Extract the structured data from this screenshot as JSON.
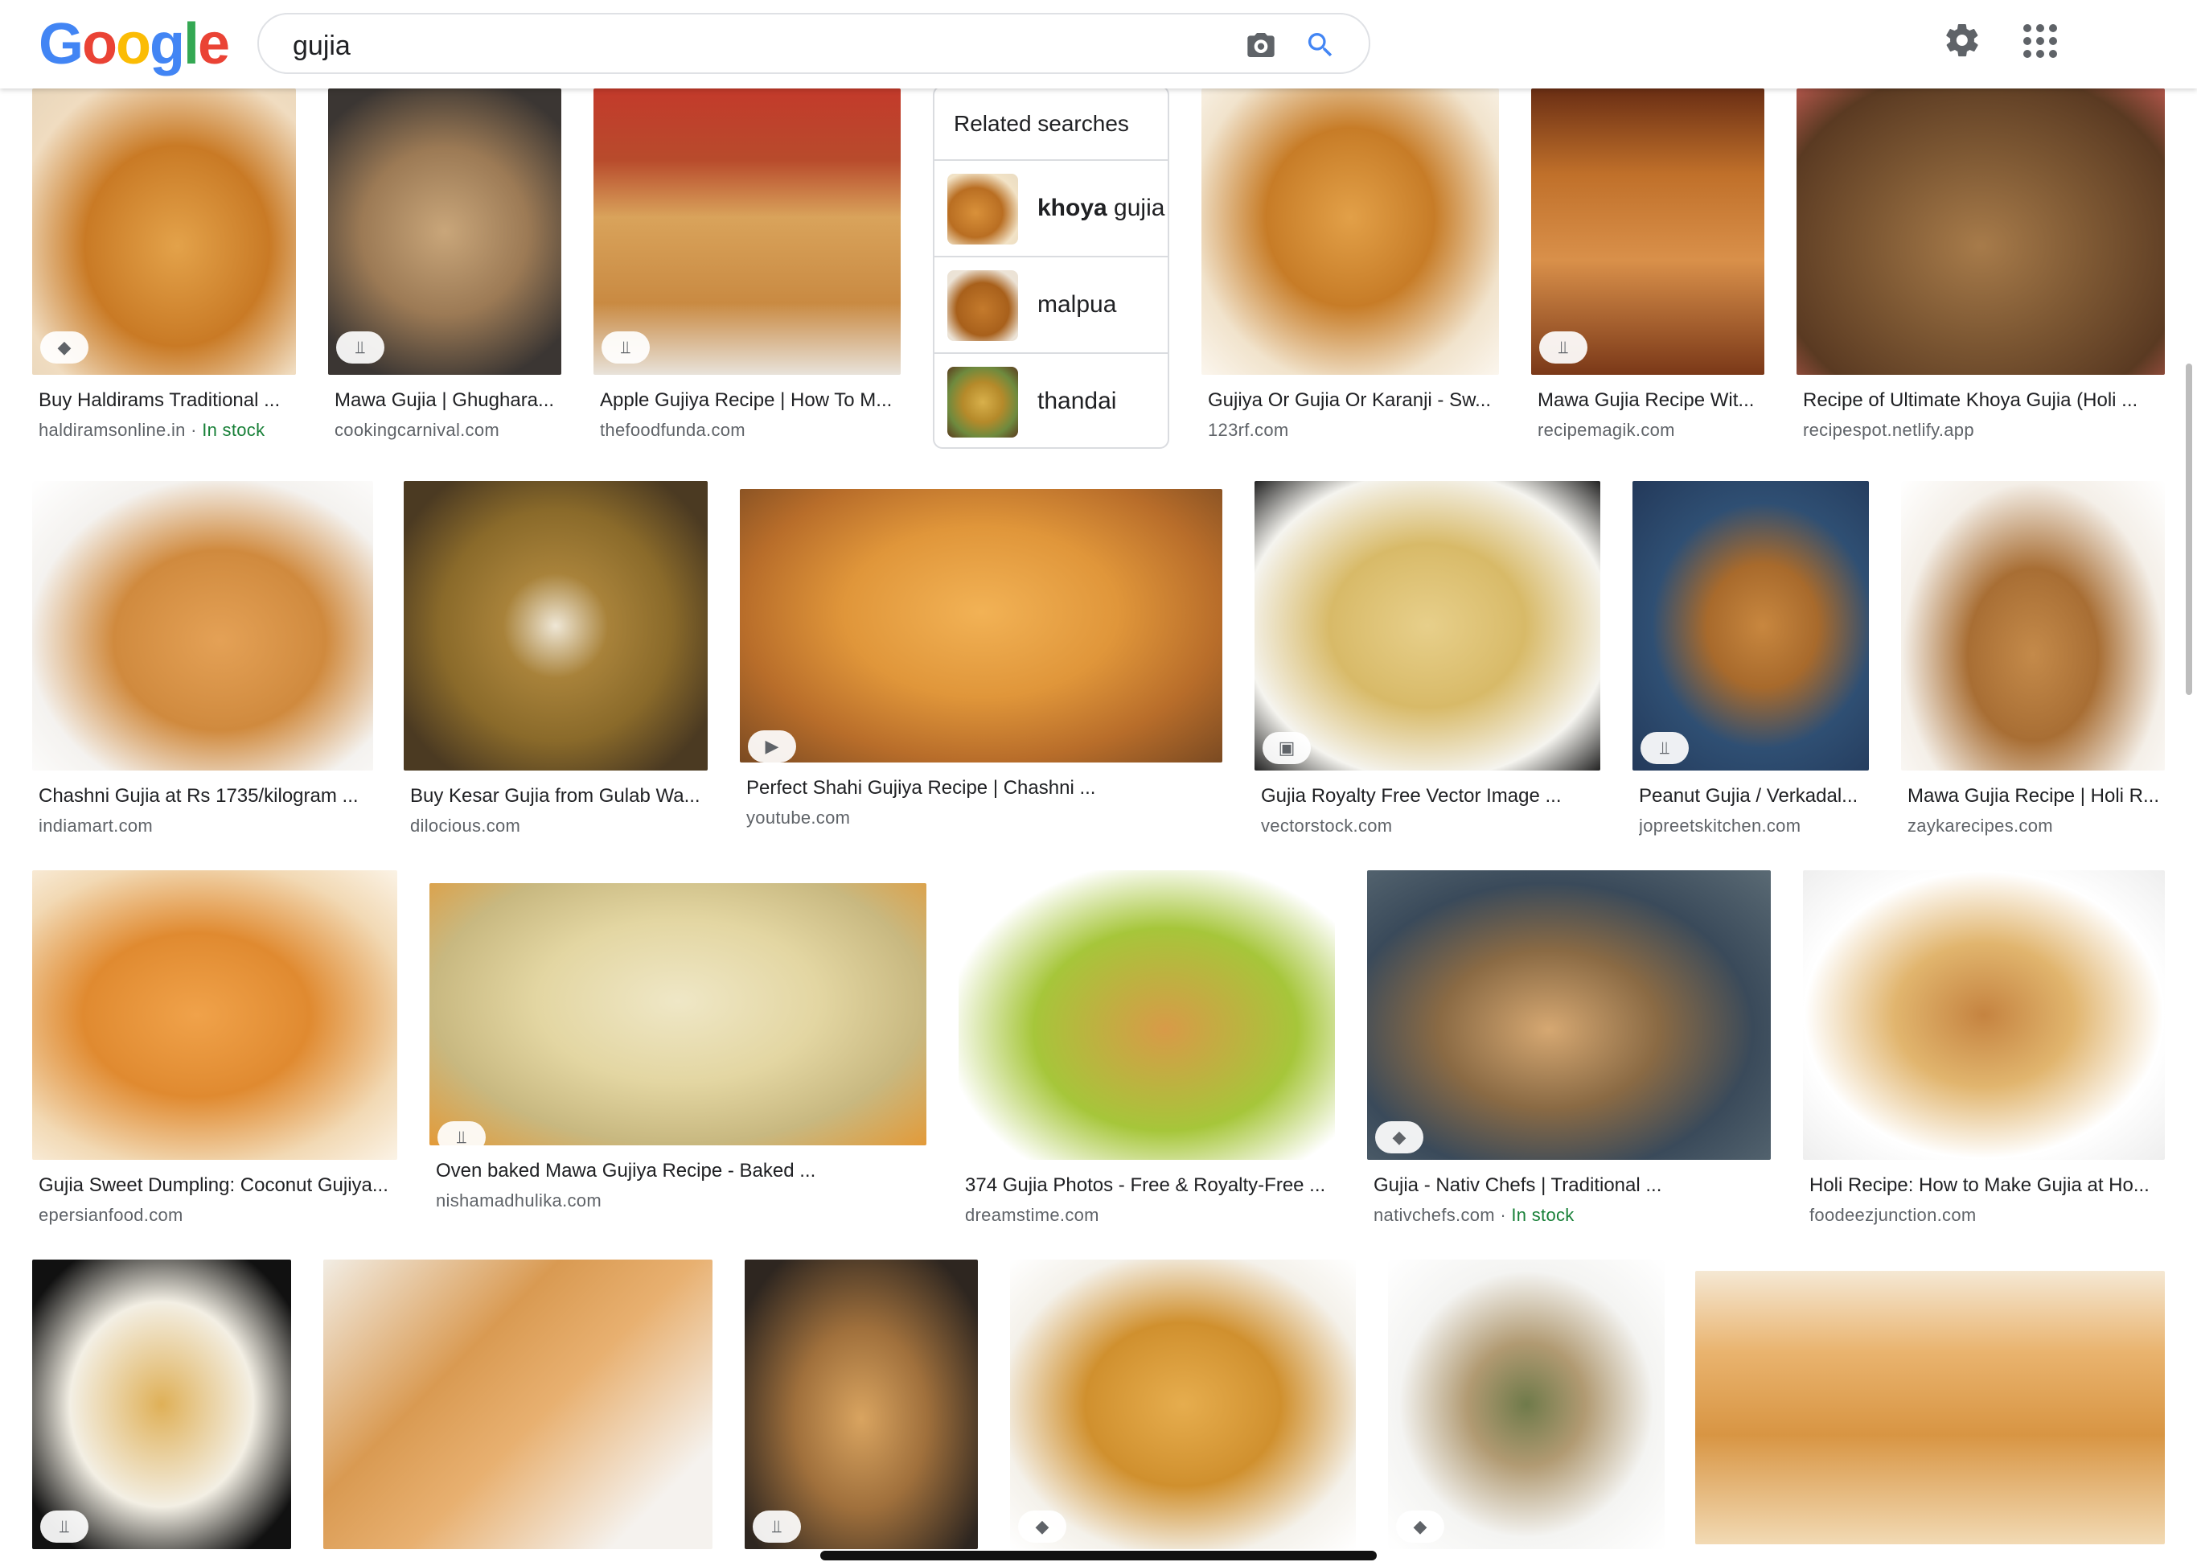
{
  "header": {
    "logo_letters": [
      {
        "ch": "G",
        "color": "#4285F4"
      },
      {
        "ch": "o",
        "color": "#EA4335"
      },
      {
        "ch": "o",
        "color": "#FBBC05"
      },
      {
        "ch": "g",
        "color": "#4285F4"
      },
      {
        "ch": "l",
        "color": "#34A853"
      },
      {
        "ch": "e",
        "color": "#EA4335"
      }
    ],
    "query": "gujia",
    "camera_icon": "camera-icon",
    "search_icon": "search-icon",
    "settings_icon": "gear-icon",
    "apps_icon": "apps-grid-icon"
  },
  "related": {
    "title": "Related searches",
    "items": [
      {
        "bold": "khoya",
        "rest": " gujia",
        "icon": "thumbnail"
      },
      {
        "bold": "",
        "rest": "malpua",
        "icon": "thumbnail"
      },
      {
        "bold": "",
        "rest": "thandai",
        "icon": "thumbnail"
      }
    ]
  },
  "results": [
    {
      "title": "Buy Haldirams Traditional ...",
      "source": "haldiramsonline.in",
      "stock": "In stock",
      "badge": "tag-icon"
    },
    {
      "title": "Mawa Gujia | Ghughara...",
      "source": "cookingcarnival.com",
      "stock": "",
      "badge": "recipe-icon"
    },
    {
      "title": "Apple Gujiya Recipe | How To M...",
      "source": "thefoodfunda.com",
      "stock": "",
      "badge": "recipe-icon"
    },
    {
      "title": "Gujiya Or Gujia Or Karanji - Sw...",
      "source": "123rf.com",
      "stock": "",
      "badge": ""
    },
    {
      "title": "Mawa Gujia Recipe Wit...",
      "source": "recipemagik.com",
      "stock": "",
      "badge": "recipe-icon"
    },
    {
      "title": "Recipe of Ultimate Khoya Gujia (Holi ...",
      "source": "recipespot.netlify.app",
      "stock": "",
      "badge": ""
    },
    {
      "title": "Chashni Gujia at Rs 1735/kilogram ...",
      "source": "indiamart.com",
      "stock": "",
      "badge": ""
    },
    {
      "title": "Buy Kesar Gujia from Gulab Wa...",
      "source": "dilocious.com",
      "stock": "",
      "badge": ""
    },
    {
      "title": "Perfect Shahi Gujiya Recipe | Chashni ...",
      "source": "youtube.com",
      "stock": "",
      "badge": "play-icon"
    },
    {
      "title": "Gujia Royalty Free Vector Image ...",
      "source": "vectorstock.com",
      "stock": "",
      "badge": "image-icon"
    },
    {
      "title": "Peanut Gujia / Verkadal...",
      "source": "jopreetskitchen.com",
      "stock": "",
      "badge": "recipe-icon"
    },
    {
      "title": "Mawa Gujia Recipe | Holi R...",
      "source": "zaykarecipes.com",
      "stock": "",
      "badge": ""
    },
    {
      "title": "Gujia Sweet Dumpling: Coconut Gujiya...",
      "source": "epersianfood.com",
      "stock": "",
      "badge": ""
    },
    {
      "title": "Oven baked Mawa Gujiya Recipe - Baked ...",
      "source": "nishamadhulika.com",
      "stock": "",
      "badge": "recipe-icon"
    },
    {
      "title": "374 Gujia Photos - Free & Royalty-Free ...",
      "source": "dreamstime.com",
      "stock": "",
      "badge": ""
    },
    {
      "title": "Gujia - Nativ Chefs | Traditional ...",
      "source": "nativchefs.com",
      "stock": "In stock",
      "badge": "tag-icon"
    },
    {
      "title": "Holi Recipe: How to Make Gujia at Ho...",
      "source": "foodeezjunction.com",
      "stock": "",
      "badge": ""
    },
    {
      "title": "",
      "source": "",
      "stock": "",
      "badge": "recipe-icon"
    },
    {
      "title": "",
      "source": "",
      "stock": "",
      "badge": ""
    },
    {
      "title": "",
      "source": "",
      "stock": "",
      "badge": "recipe-icon"
    },
    {
      "title": "",
      "source": "",
      "stock": "",
      "badge": "tag-icon"
    },
    {
      "title": "",
      "source": "",
      "stock": "",
      "badge": "tag-icon"
    },
    {
      "title": "",
      "source": "",
      "stock": "",
      "badge": ""
    }
  ],
  "colors": {
    "stock_green": "#188038",
    "source_gray": "#5f6368",
    "border": "#dadce0"
  }
}
